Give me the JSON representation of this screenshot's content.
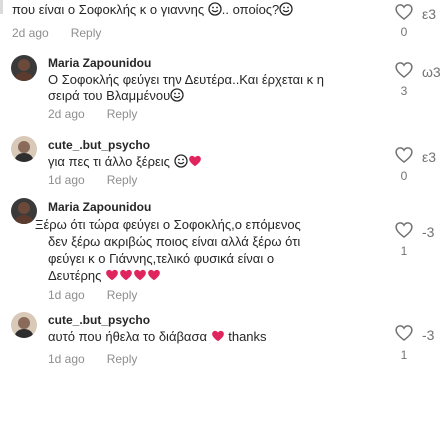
{
  "comments": [
    {
      "username": "",
      "lines": [
        "που είναι ο Σοφοκλής κ ο γιαννης ",
        ".. οποίος?"
      ],
      "time": "2d ago",
      "reply": "Reply",
      "likes": "0"
    },
    {
      "username": "Maria Zapounidou",
      "lines": [
        "Ο Σοφοκλής φεύγει την Δευτέρα..Και έρχεται κ η",
        "σειρά του Βλαμμένου"
      ],
      "time": "2d ago",
      "reply": "Reply",
      "likes": "3"
    },
    {
      "username": "cute_.but_psycho",
      "lines": [
        "για πες τι άλλο ξέρεις "
      ],
      "time": "1d ago",
      "reply": "Reply",
      "likes": "0"
    },
    {
      "username": "Maria Zapounidou",
      "lines": [
        "Ξέρω ότι τώρα φεύγει ο Σοφοκλής,ο επόμενος",
        "δεν ξέρω ακριβώς ποιος είναι αλλά ξέρω ότι",
        "φεύγει κ ο Γιάννης,τελικό φυσικά είναι ο",
        "Δευτέρης "
      ],
      "time": "1d ago",
      "reply": "Reply",
      "likes": "1"
    },
    {
      "username": "cute_.but_psycho",
      "lines": [
        "αυτό που ήθελα το διάβασα ",
        " thanks"
      ],
      "time": "1d ago",
      "reply": "Reply",
      "likes": "1"
    }
  ],
  "side_marks": [
    "ε3",
    "ω3",
    "ε3",
    "-3",
    "-3"
  ],
  "colors": {
    "heart": "#e0245e",
    "text": "#262626",
    "muted": "#8e8e8e"
  },
  "icons": [
    "heart-outline-icon",
    "red-heart-emoji",
    "smile-emoji",
    "avatar-icon"
  ]
}
